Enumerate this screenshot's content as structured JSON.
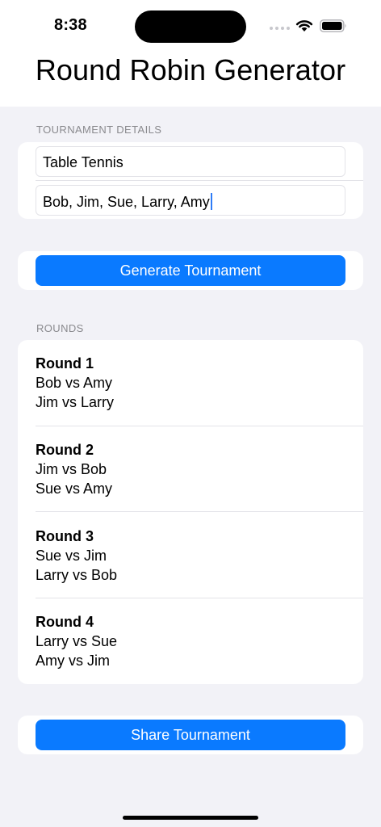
{
  "status_bar": {
    "time": "8:38"
  },
  "nav": {
    "title": "Round Robin Generator"
  },
  "details_section": {
    "header": "TOURNAMENT DETAILS",
    "name_value": "Table Tennis",
    "players_value": "Bob, Jim, Sue, Larry, Amy"
  },
  "generate_button": {
    "label": "Generate Tournament"
  },
  "rounds_section": {
    "header": "ROUNDS",
    "rounds": [
      {
        "title": "Round 1",
        "matches": [
          "Bob vs Amy",
          "Jim vs Larry"
        ]
      },
      {
        "title": "Round 2",
        "matches": [
          "Jim vs Bob",
          "Sue vs Amy"
        ]
      },
      {
        "title": "Round 3",
        "matches": [
          "Sue vs Jim",
          "Larry vs Bob"
        ]
      },
      {
        "title": "Round 4",
        "matches": [
          "Larry vs Sue",
          "Amy vs Jim"
        ]
      }
    ]
  },
  "share_button": {
    "label": "Share Tournament"
  },
  "colors": {
    "accent": "#0a7aff",
    "background": "#f2f2f7",
    "section_header": "#8a8a8e"
  },
  "icons": {
    "signal": "cellular-signal-icon",
    "wifi": "wifi-icon",
    "battery": "battery-icon"
  }
}
